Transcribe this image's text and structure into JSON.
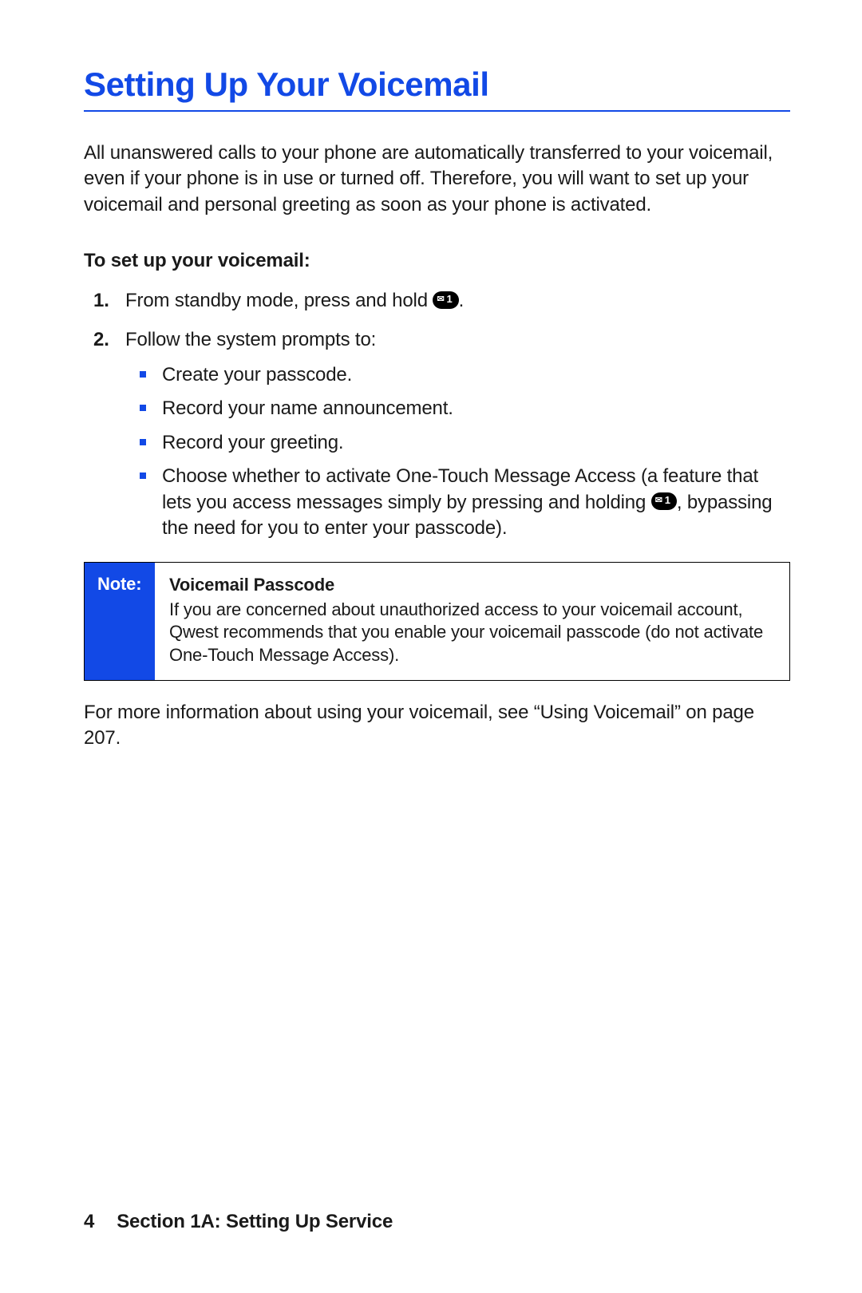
{
  "title": "Setting Up Your Voicemail",
  "intro": "All unanswered calls to your phone are automatically transferred to your voicemail, even if your phone is in use or turned off. Therefore, you will want to set up your voicemail and personal greeting as soon as your phone is activated.",
  "subheading": "To set up your voicemail:",
  "step1_pre": "From standby mode, press and hold ",
  "step1_post": ".",
  "key_label": "1",
  "step2_lead": "Follow the system prompts to:",
  "bullets": {
    "b1": "Create your passcode.",
    "b2": "Record your name announcement.",
    "b3": "Record your greeting.",
    "b4_pre": "Choose whether to activate One-Touch Message Access (a feature that lets you access messages simply by pressing and holding ",
    "b4_post": ", bypassing the need for you to enter your passcode)."
  },
  "note": {
    "tab": "Note:",
    "title": "Voicemail Passcode",
    "body": "If you are concerned about unauthorized access to your voicemail account, Qwest recommends that you enable your voicemail passcode (do not activate One-Touch Message Access)."
  },
  "moreinfo": "For more information about using your voicemail, see “Using Voicemail” on page 207.",
  "footer": {
    "page_number": "4",
    "section": "Section 1A: Setting Up Service"
  }
}
